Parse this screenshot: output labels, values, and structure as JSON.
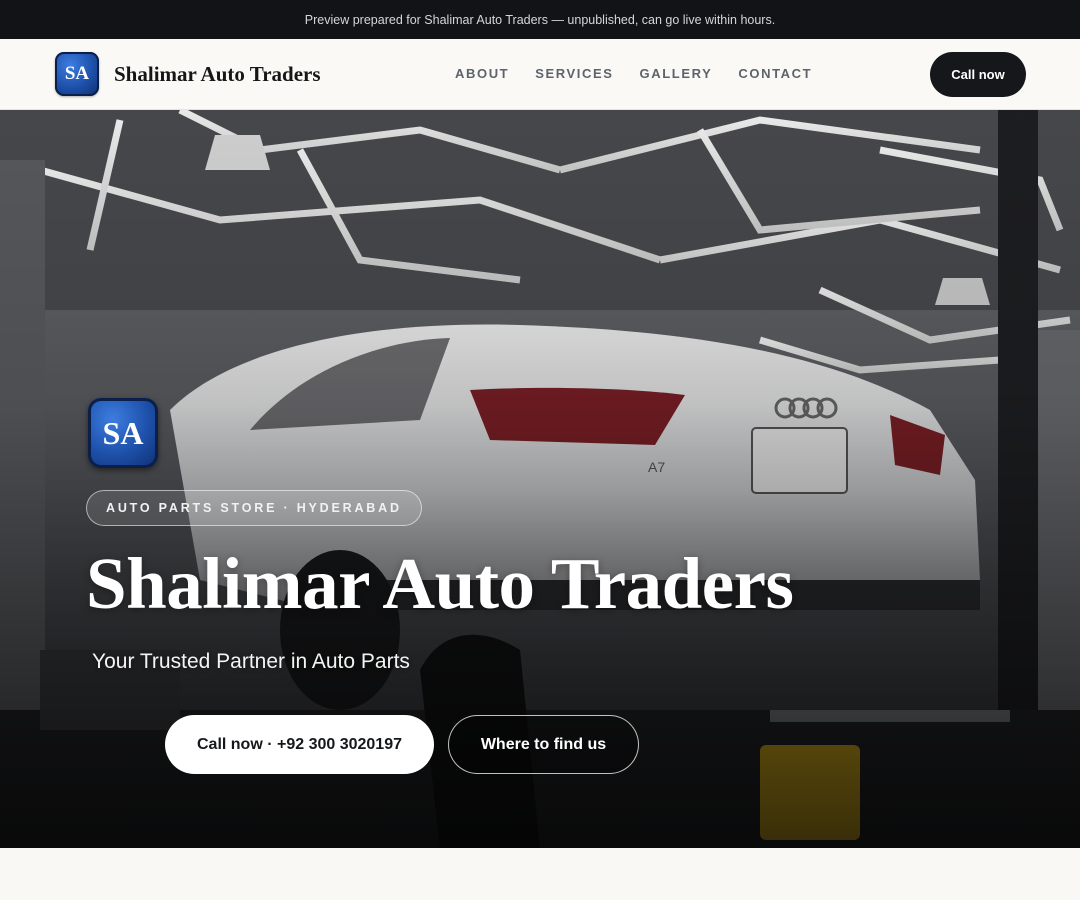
{
  "preview_bar": {
    "text": "Preview prepared for Shalimar Auto Traders — unpublished, can go live within hours."
  },
  "nav": {
    "logo_initials": "SA",
    "brand_name": "Shalimar Auto Traders",
    "links": [
      "ABOUT",
      "SERVICES",
      "GALLERY",
      "CONTACT"
    ],
    "cta_label": "Call now"
  },
  "hero": {
    "logo_initials": "SA",
    "eyebrow": "AUTO PARTS STORE · HYDERABAD",
    "title": "Shalimar Auto Traders",
    "subtitle": "Your Trusted Partner in Auto Parts",
    "primary_button": "Call now · +92 300 3020197",
    "secondary_button": "Where to find us",
    "background_image": "car on lift in workshop with hexagonal ceiling lights",
    "car_badge": "A7"
  },
  "colors": {
    "dark": "#15171b",
    "logo_blue": "#1d4fa8",
    "page_bg": "#f9f8f5"
  }
}
